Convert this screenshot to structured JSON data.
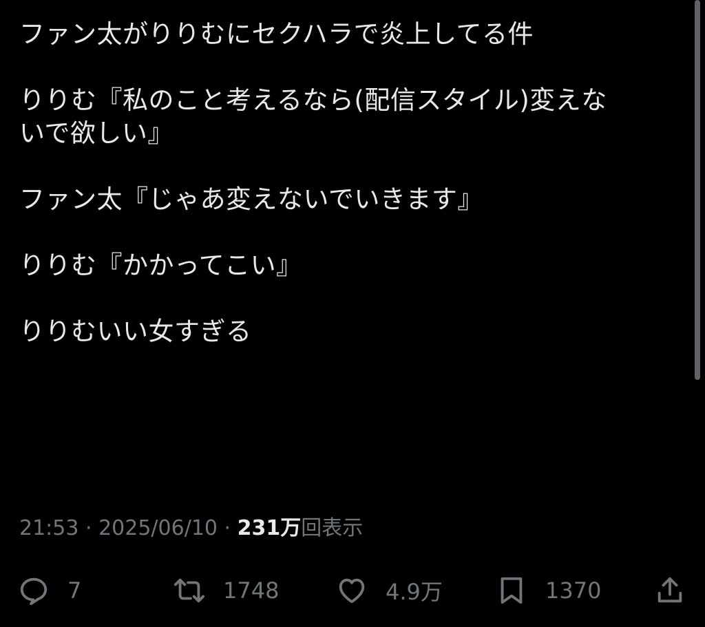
{
  "post": {
    "lines": [
      "ファン太がりりむにセクハラで炎上してる件",
      "りりむ『私のこと考えるなら(配信スタイル)変えな",
      "いで欲しい』",
      "ファン太『じゃあ変えないでいきます』",
      "りりむ『かかってこい』",
      "りりむいい女すぎる"
    ],
    "time": "21:53",
    "separator": " · ",
    "date": "2025/06/10",
    "views_count": "231万",
    "views_label": "回表示"
  },
  "actions": {
    "reply_count": "7",
    "repost_count": "1748",
    "like_count": "4.9万",
    "bookmark_count": "1370"
  },
  "icons": {
    "reply": "reply-icon",
    "repost": "repost-icon",
    "like": "heart-icon",
    "bookmark": "bookmark-icon",
    "share": "share-icon"
  },
  "colors": {
    "background": "#000000",
    "text": "#e7e9ea",
    "muted": "#71767b"
  }
}
